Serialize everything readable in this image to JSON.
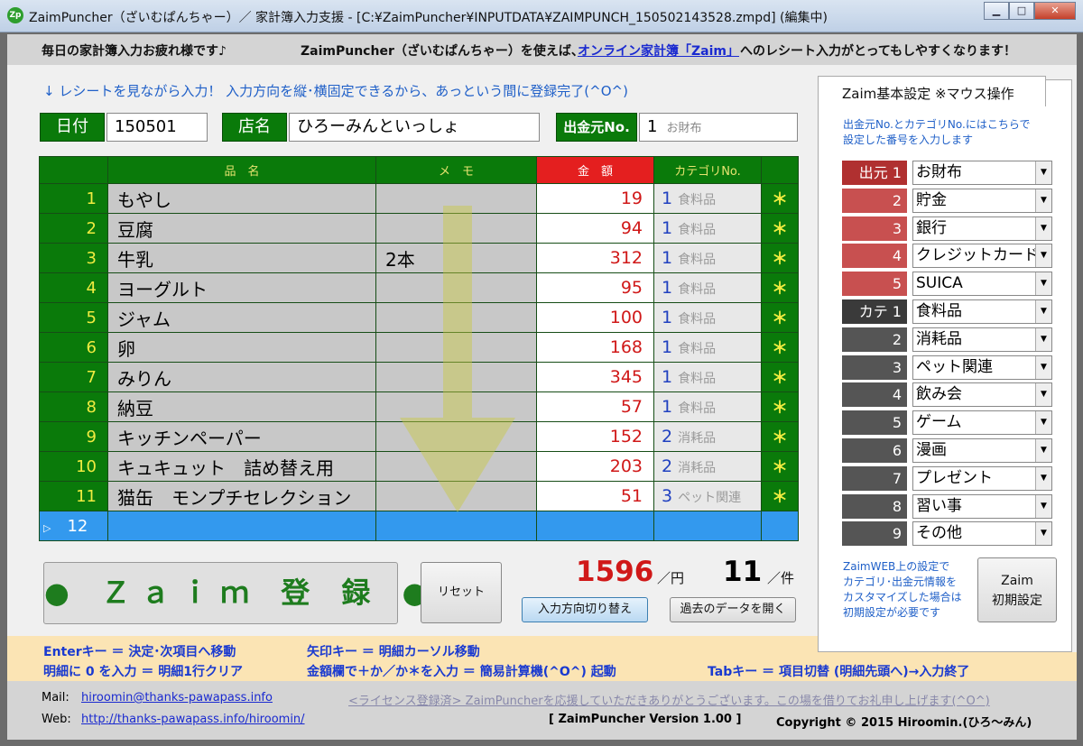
{
  "window": {
    "title": "ZaimPuncher（ざいむぱんちゃー）／ 家計簿入力支援 - [C:¥ZaimPuncher¥INPUTDATA¥ZAIMPUNCH_150502143528.zmpd] (編集中)",
    "icon": "Zp",
    "min": "▁",
    "max": "□",
    "close": "✕"
  },
  "banner": {
    "greeting": "毎日の家計簿入力お疲れ様です♪",
    "mid": "ZaimPuncher（ざいむぱんちゃー）を使えば、",
    "link": "オンライン家計簿「Zaim」",
    "tail": "へのレシート入力がとってもしやすくなります！"
  },
  "guide": "↓ レシートを見ながら入力！ 入力方向を縦･横固定できるから、あっという間に登録完了(^O^)",
  "header": {
    "date_label": "日付",
    "date_value": "150501",
    "shop_label": "店名",
    "shop_value": "ひろーみんといっしょ",
    "source_label": "出金元No.",
    "source_value": "1",
    "source_name": "お財布"
  },
  "table": {
    "columns": {
      "name": "品　名",
      "memo": "メ　モ",
      "amount": "金　額",
      "category": "カテゴリNo."
    },
    "rows": [
      {
        "no": "1",
        "name": "もやし",
        "memo": "",
        "amount": "19",
        "cat": "1",
        "cat_name": "食料品",
        "mark": "＊"
      },
      {
        "no": "2",
        "name": "豆腐",
        "memo": "",
        "amount": "94",
        "cat": "1",
        "cat_name": "食料品",
        "mark": "＊"
      },
      {
        "no": "3",
        "name": "牛乳",
        "memo": "2本",
        "amount": "312",
        "cat": "1",
        "cat_name": "食料品",
        "mark": "＊"
      },
      {
        "no": "4",
        "name": "ヨーグルト",
        "memo": "",
        "amount": "95",
        "cat": "1",
        "cat_name": "食料品",
        "mark": "＊"
      },
      {
        "no": "5",
        "name": "ジャム",
        "memo": "",
        "amount": "100",
        "cat": "1",
        "cat_name": "食料品",
        "mark": "＊"
      },
      {
        "no": "6",
        "name": "卵",
        "memo": "",
        "amount": "168",
        "cat": "1",
        "cat_name": "食料品",
        "mark": "＊"
      },
      {
        "no": "7",
        "name": "みりん",
        "memo": "",
        "amount": "345",
        "cat": "1",
        "cat_name": "食料品",
        "mark": "＊"
      },
      {
        "no": "8",
        "name": "納豆",
        "memo": "",
        "amount": "57",
        "cat": "1",
        "cat_name": "食料品",
        "mark": "＊"
      },
      {
        "no": "9",
        "name": "キッチンペーパー",
        "memo": "",
        "amount": "152",
        "cat": "2",
        "cat_name": "消耗品",
        "mark": "＊"
      },
      {
        "no": "10",
        "name": "キュキュット　詰め替え用",
        "memo": "",
        "amount": "203",
        "cat": "2",
        "cat_name": "消耗品",
        "mark": "＊"
      },
      {
        "no": "11",
        "name": "猫缶　モンプチセレクション",
        "memo": "",
        "amount": "51",
        "cat": "3",
        "cat_name": "ペット関連",
        "mark": "＊"
      }
    ],
    "current_row": {
      "marker": "▷",
      "no": "12"
    }
  },
  "actions": {
    "zaim_register": "● Ｚａｉｍ 登 録 ●",
    "reset": "リセット",
    "toggle_direction": "入力方向切り替え",
    "open_past": "過去のデータを開く"
  },
  "summary": {
    "total": "1596",
    "total_unit": "／円",
    "count": "11",
    "count_unit": "／件"
  },
  "settings": {
    "tab": "Zaim基本設定 ※マウス操作",
    "note1": "出金元No.とカテゴリNo.にはこちらで",
    "note2": "設定した番号を入力します",
    "sources": [
      {
        "tag": "出元 1",
        "value": "お財布"
      },
      {
        "tag": "2",
        "value": "貯金"
      },
      {
        "tag": "3",
        "value": "銀行"
      },
      {
        "tag": "4",
        "value": "クレジットカード"
      },
      {
        "tag": "5",
        "value": "SUICA"
      }
    ],
    "categories": [
      {
        "tag": "カテ 1",
        "value": "食料品"
      },
      {
        "tag": "2",
        "value": "消耗品"
      },
      {
        "tag": "3",
        "value": "ペット関連"
      },
      {
        "tag": "4",
        "value": "飲み会"
      },
      {
        "tag": "5",
        "value": "ゲーム"
      },
      {
        "tag": "6",
        "value": "漫画"
      },
      {
        "tag": "7",
        "value": "プレゼント"
      },
      {
        "tag": "8",
        "value": "習い事"
      },
      {
        "tag": "9",
        "value": "その他"
      }
    ],
    "bottom_note": [
      "ZaimWEB上の設定で",
      "カテゴリ･出金元情報を",
      "カスタマイズした場合は",
      "初期設定が必要です"
    ],
    "init_btn_1": "Zaim",
    "init_btn_2": "初期設定"
  },
  "help": {
    "l1a": "Enterキー ＝ 決定･次項目へ移動",
    "l1b": "矢印キー ＝ 明細カーソル移動",
    "l2a": "明細に 0 を入力 ＝ 明細1行クリア",
    "l2b": "金額欄で＋か／か＊を入力 ＝ 簡易計算機(^O^) 起動",
    "l2c": "Tabキー ＝ 項目切替 (明細先頭へ)→入力終了"
  },
  "footer": {
    "mail_label": "Mail:",
    "mail": "hiroomin@thanks-pawapass.info",
    "web_label": "Web:",
    "web": "http://thanks-pawapass.info/hiroomin/",
    "license": "<ライセンス登録済> ZaimPuncherを応援していただきありがとうございます。この場を借りてお礼申し上げます(^O^)",
    "version": "[ ZaimPuncher Version 1.00 ]",
    "copyright": "Copyright © 2015 Hiroomin.(ひろ～みん)"
  }
}
